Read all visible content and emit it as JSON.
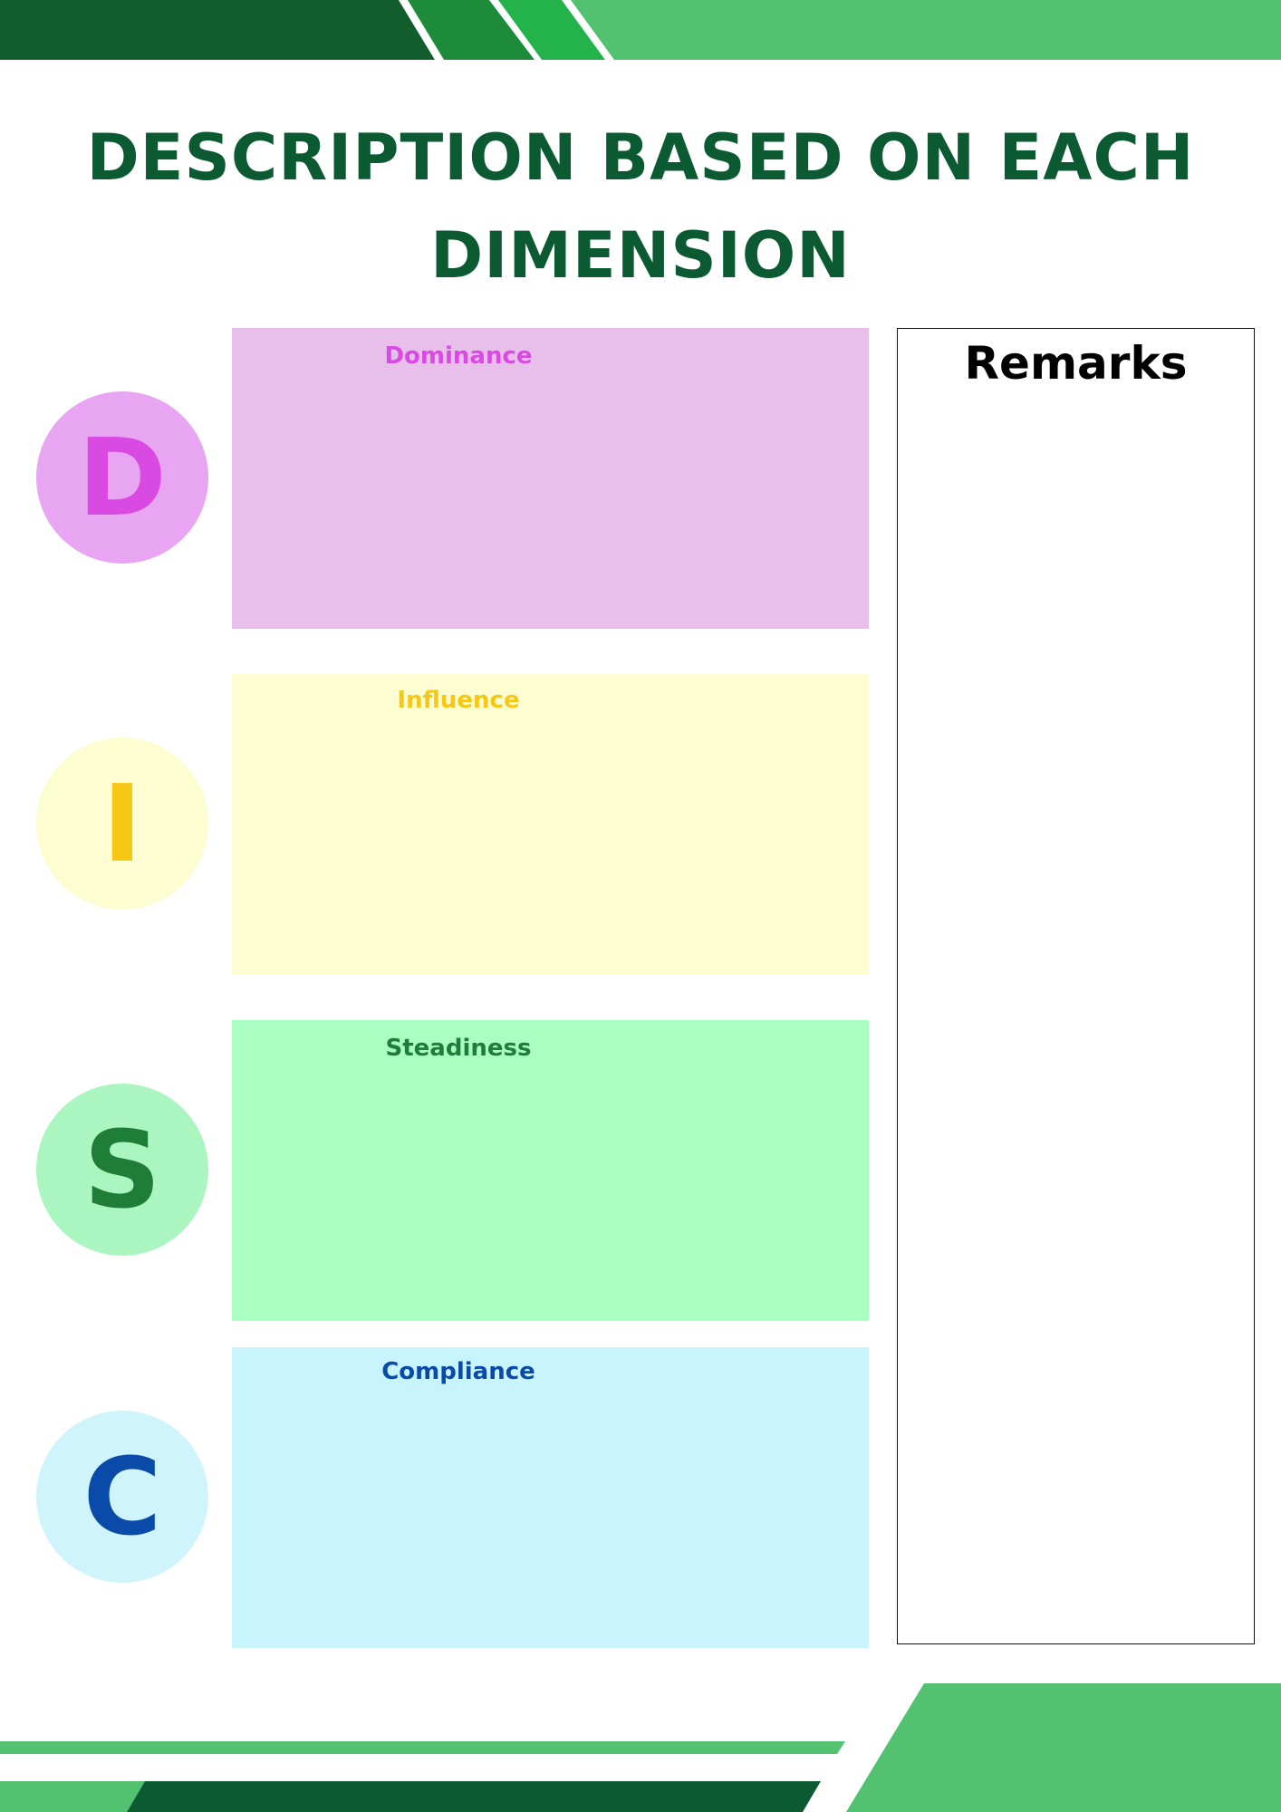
{
  "document": {
    "title": "DESCRIPTION BASED ON EACH DIMENSION"
  },
  "dimensions": [
    {
      "letter": "D",
      "name": "Dominance",
      "box_color": "#e8bfeb",
      "circle_color": "#e8a5f1",
      "text_color": "#d94ae3"
    },
    {
      "letter": "I",
      "name": "Influence",
      "box_color": "#fcfdd0",
      "circle_color": "#fcfdd0",
      "text_color": "#f7c715"
    },
    {
      "letter": "S",
      "name": "Steadiness",
      "box_color": "#abfec2",
      "circle_color": "#abf5c1",
      "text_color": "#1e7d36"
    },
    {
      "letter": "C",
      "name": "Compliance",
      "box_color": "#c8f5fd",
      "circle_color": "#d0f4fb",
      "text_color": "#0a4aa8"
    }
  ],
  "remarks": {
    "title": "Remarks"
  },
  "theme": {
    "green_dark": "#135c2c",
    "green_mid": "#1e8b3a",
    "green_bright": "#24b24a",
    "green_light": "#52c270",
    "green_deep": "#0b5a32"
  }
}
